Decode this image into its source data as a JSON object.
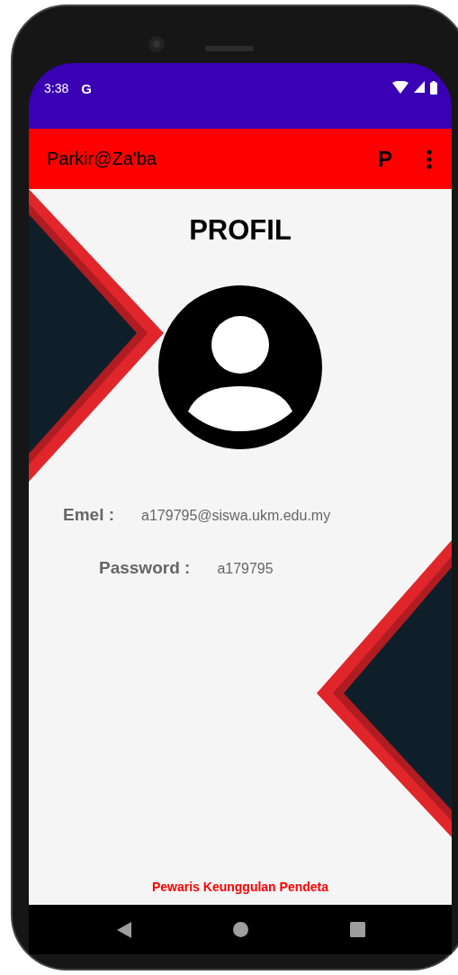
{
  "status_bar": {
    "time": "3:38",
    "notification": "G"
  },
  "app_bar": {
    "title": "Parkir@Za'ba",
    "action": "P"
  },
  "profile": {
    "title": "PROFIL",
    "fields": [
      {
        "label": "Emel :",
        "value": "a179795@siswa.ukm.edu.my"
      },
      {
        "label": "Password :",
        "value": "a179795"
      }
    ],
    "footer": "Pewaris Keunggulan Pendeta"
  }
}
